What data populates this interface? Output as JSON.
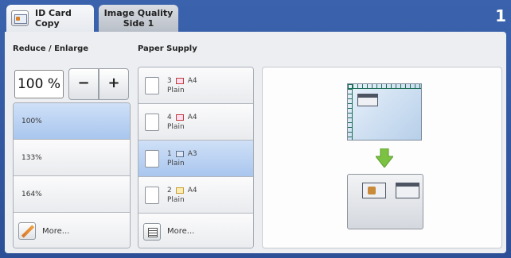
{
  "tabs": {
    "active": {
      "line1": "ID Card",
      "line2": "Copy",
      "icon": "id-card-icon"
    },
    "inactive": {
      "line1": "Image Quality",
      "line2": "Side 1"
    }
  },
  "page_indicator": "1",
  "reduce_enlarge": {
    "title": "Reduce / Enlarge",
    "value": "100 %",
    "minus": "−",
    "plus": "+",
    "presets": [
      "100%",
      "133%",
      "164%"
    ],
    "selected_index": 0,
    "more_label": "More..."
  },
  "paper_supply": {
    "title": "Paper Supply",
    "trays": [
      {
        "tray": "3",
        "size": "A4",
        "type": "Plain"
      },
      {
        "tray": "4",
        "size": "A4",
        "type": "Plain"
      },
      {
        "tray": "1",
        "size": "A3",
        "type": "Plain"
      },
      {
        "tray": "2",
        "size": "A4",
        "type": "Plain"
      }
    ],
    "selected_index": 2,
    "more_label": "More..."
  },
  "colors": {
    "header": "#3b63ad",
    "selected_row": "#a9c6ee",
    "arrow": "#7cc242"
  }
}
